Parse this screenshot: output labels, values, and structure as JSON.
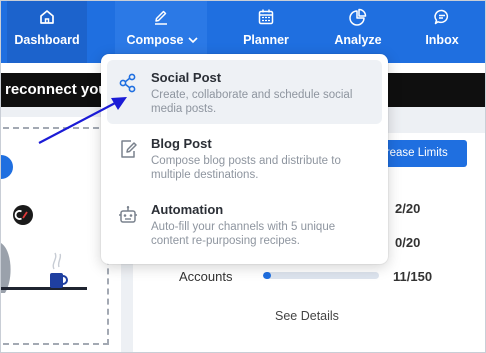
{
  "nav": {
    "items": [
      {
        "label": "Dashboard",
        "icon": "home-icon"
      },
      {
        "label": "Compose",
        "icon": "pencil-icon"
      },
      {
        "label": "Planner",
        "icon": "calendar-icon"
      },
      {
        "label": "Analyze",
        "icon": "pie-chart-icon"
      },
      {
        "label": "Inbox",
        "icon": "chat-bubble-icon"
      }
    ],
    "compose_chevron": "chevron-down-icon"
  },
  "banner": {
    "text": "reconnect your"
  },
  "usage": {
    "increase_limits_label": "crease Limits",
    "stat1": "2/20",
    "stat2": "0/20",
    "accounts_label": "Accounts",
    "accounts_value": "11/150",
    "accounts_progress": 0.07,
    "see_details_label": "See Details"
  },
  "compose_menu": {
    "items": [
      {
        "title": "Social Post",
        "description": "Create, collaborate and schedule social media posts.",
        "icon": "share-icon"
      },
      {
        "title": "Blog Post",
        "description": "Compose blog posts and distribute to multiple destinations.",
        "icon": "document-edit-icon"
      },
      {
        "title": "Automation",
        "description": "Auto-fill your channels with 5 unique content re-purposing recipes.",
        "icon": "robot-icon"
      }
    ]
  },
  "colors": {
    "primary": "#1f6fe0",
    "banner": "#0f0f0f",
    "arrow": "#1b1bd6",
    "background": "#edf0f4"
  }
}
